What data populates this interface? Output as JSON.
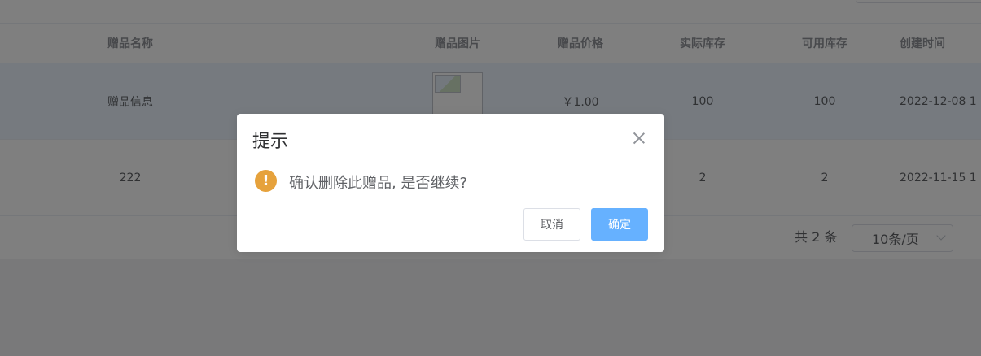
{
  "table": {
    "headers": [
      "赠品名称",
      "赠品图片",
      "赠品价格",
      "实际库存",
      "可用库存",
      "创建时间"
    ],
    "rows": [
      {
        "name": "赠品信息",
        "price": "￥1.00",
        "actual_stock": "100",
        "available_stock": "100",
        "created": "2022-12-08 1"
      },
      {
        "name": "222",
        "price": "",
        "actual_stock": "2",
        "available_stock": "2",
        "created": "2022-11-15 1"
      }
    ]
  },
  "pagination": {
    "total": "共 2 条",
    "page_size": "10条/页"
  },
  "dialog": {
    "title": "提示",
    "message": "确认删除此赠品, 是否继续?",
    "warning_glyph": "!",
    "cancel_label": "取消",
    "confirm_label": "确定"
  },
  "colors": {
    "warning": "#e6a23c",
    "primary_light": "#66b1ff",
    "row_highlight": "#ecf5ff"
  }
}
